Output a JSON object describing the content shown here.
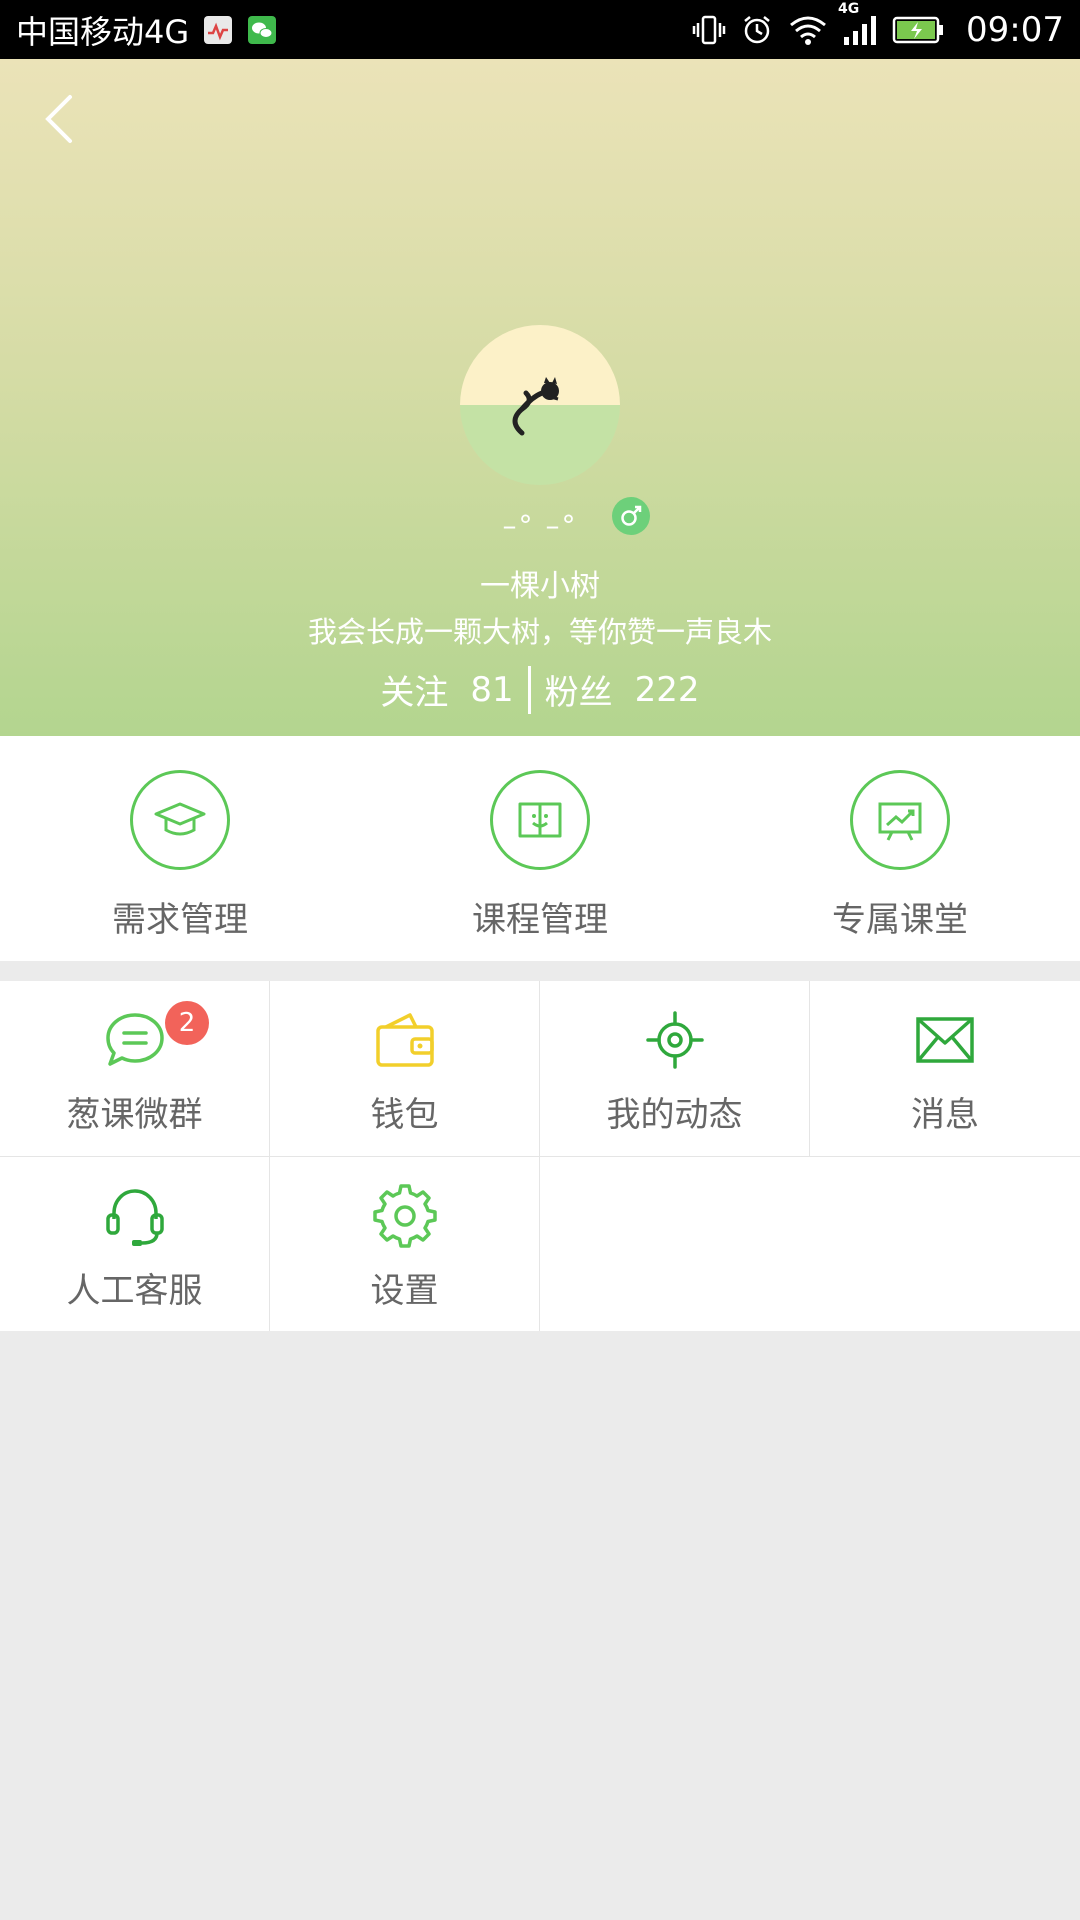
{
  "status_bar": {
    "carrier": "中国移动4G",
    "network_label": "4G",
    "time": "09:07",
    "icons": [
      "health-app-icon",
      "wechat-icon",
      "vibrate-icon",
      "alarm-icon",
      "wifi-icon",
      "signal-icon",
      "battery-charging-icon"
    ]
  },
  "profile": {
    "nickname": "–° –°",
    "username": "一棵小树",
    "motto": "我会长成一颗大树，等你赞一声良木",
    "follow_label": "关注",
    "follow_count": "81",
    "fans_label": "粉丝",
    "fans_count": "222",
    "gender": "male-icon"
  },
  "top_menu": [
    {
      "label": "需求管理",
      "icon": "graduation-cap-icon"
    },
    {
      "label": "课程管理",
      "icon": "open-book-icon"
    },
    {
      "label": "专属课堂",
      "icon": "presentation-board-icon"
    }
  ],
  "grid_menu": [
    {
      "label": "葱课微群",
      "icon": "chat-bubble-icon",
      "badge": "2"
    },
    {
      "label": "钱包",
      "icon": "wallet-icon"
    },
    {
      "label": "我的动态",
      "icon": "target-icon"
    },
    {
      "label": "消息",
      "icon": "envelope-icon"
    },
    {
      "label": "人工客服",
      "icon": "headset-icon"
    },
    {
      "label": "设置",
      "icon": "gear-icon"
    }
  ],
  "colors": {
    "accent_green": "#5cc857",
    "wallet_yellow": "#f2cf2b",
    "badge_red": "#f2635a",
    "label_gray": "#666666"
  }
}
